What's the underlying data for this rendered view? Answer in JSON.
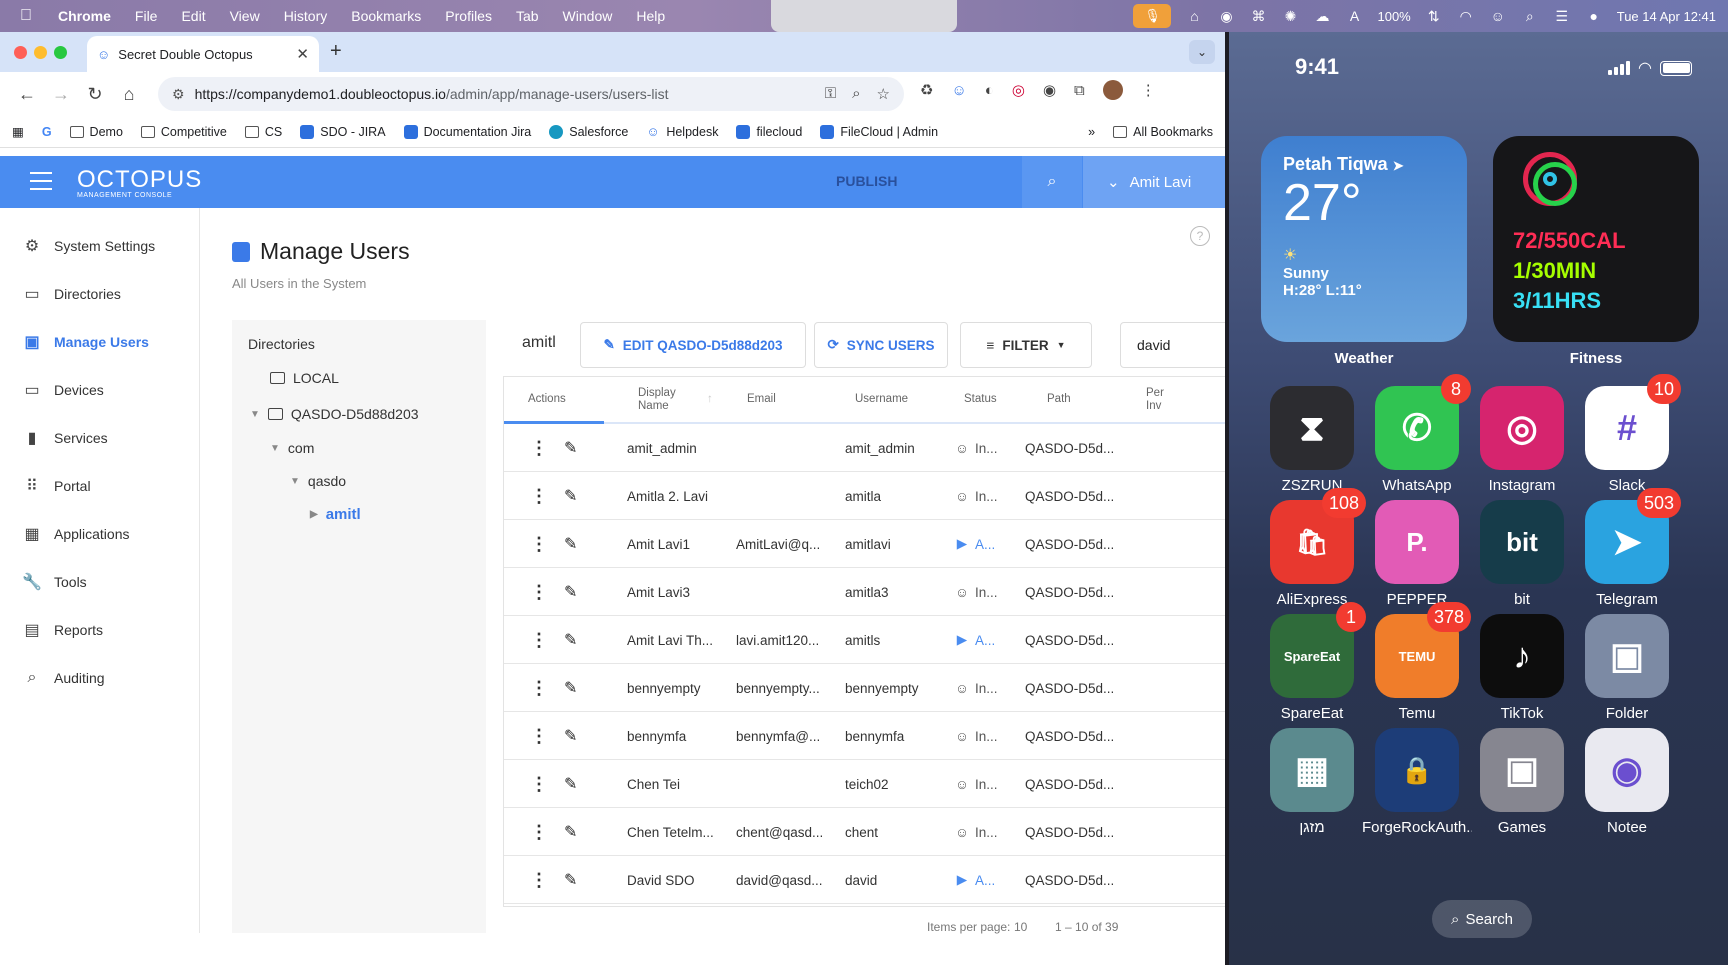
{
  "mac_menu": {
    "app": "Chrome",
    "items": [
      "File",
      "Edit",
      "View",
      "History",
      "Bookmarks",
      "Profiles",
      "Tab",
      "Window",
      "Help"
    ],
    "battery": "100%",
    "datetime": "Tue 14 Apr  12:41"
  },
  "browser": {
    "tab_title": "Secret Double Octopus",
    "url_host": "https://companydemo1.doubleoctopus.io",
    "url_path": "/admin/app/manage-users/users-list",
    "bookmarks": [
      "Demo",
      "Competitive",
      "CS",
      "SDO - JIRA",
      "Documentation Jira",
      "Salesforce",
      "Helpdesk",
      "filecloud",
      "FileCloud | Admin"
    ],
    "all_bookmarks": "All Bookmarks"
  },
  "app": {
    "logo": "OCTOPUS",
    "logo_sub": "MANAGEMENT CONSOLE",
    "publish": "PUBLISH",
    "user": "Amit Lavi",
    "sidebar": [
      {
        "label": "System Settings",
        "icon": "gear-icon"
      },
      {
        "label": "Directories",
        "icon": "folder-icon"
      },
      {
        "label": "Manage Users",
        "icon": "user-badge-icon"
      },
      {
        "label": "Devices",
        "icon": "laptop-icon"
      },
      {
        "label": "Services",
        "icon": "bookmark-icon"
      },
      {
        "label": "Portal",
        "icon": "grid-icon"
      },
      {
        "label": "Applications",
        "icon": "apps-icon"
      },
      {
        "label": "Tools",
        "icon": "wrench-icon"
      },
      {
        "label": "Reports",
        "icon": "clipboard-icon"
      },
      {
        "label": "Auditing",
        "icon": "audit-icon"
      }
    ],
    "page_title": "Manage Users",
    "page_subtitle": "All Users in the System",
    "directories": {
      "heading": "Directories",
      "local": "LOCAL",
      "root": "QASDO-D5d88d203",
      "com": "com",
      "qasdo": "qasdo",
      "selected": "amitl"
    },
    "grid": {
      "current_dir": "amitl",
      "edit_label": "EDIT QASDO-D5d88d203",
      "sync_label": "SYNC USERS",
      "filter_label": "FILTER",
      "search_value": "david",
      "columns": {
        "actions": "Actions",
        "display_name_1": "Display",
        "display_name_2": "Name",
        "email": "Email",
        "username": "Username",
        "status": "Status",
        "path": "Path",
        "per_1": "Per",
        "per_2": "Inv"
      },
      "rows": [
        {
          "name": "amit_admin",
          "email": "",
          "username": "amit_admin",
          "status": "In...",
          "active": false,
          "path": "QASDO-D5d..."
        },
        {
          "name": "Amitla 2. Lavi",
          "email": "",
          "username": "amitla",
          "status": "In...",
          "active": false,
          "path": "QASDO-D5d..."
        },
        {
          "name": "Amit Lavi1",
          "email": "AmitLavi@q...",
          "username": "amitlavi",
          "status": "A...",
          "active": true,
          "path": "QASDO-D5d..."
        },
        {
          "name": "Amit Lavi3",
          "email": "",
          "username": "amitla3",
          "status": "In...",
          "active": false,
          "path": "QASDO-D5d..."
        },
        {
          "name": "Amit Lavi Th...",
          "email": "lavi.amit120...",
          "username": "amitls",
          "status": "A...",
          "active": true,
          "path": "QASDO-D5d..."
        },
        {
          "name": "bennyempty",
          "email": "bennyempty...",
          "username": "bennyempty",
          "status": "In...",
          "active": false,
          "path": "QASDO-D5d..."
        },
        {
          "name": "bennymfa",
          "email": "bennymfa@...",
          "username": "bennymfa",
          "status": "In...",
          "active": false,
          "path": "QASDO-D5d..."
        },
        {
          "name": "Chen Tei",
          "email": "",
          "username": "teich02",
          "status": "In...",
          "active": false,
          "path": "QASDO-D5d..."
        },
        {
          "name": "Chen Tetelm...",
          "email": "chent@qasd...",
          "username": "chent",
          "status": "In...",
          "active": false,
          "path": "QASDO-D5d..."
        },
        {
          "name": "David SDO",
          "email": "david@qasd...",
          "username": "david",
          "status": "A...",
          "active": true,
          "path": "QASDO-D5d..."
        }
      ],
      "items_per_page_label": "Items per page:",
      "items_per_page": "10",
      "range": "1 – 10 of 39"
    }
  },
  "phone": {
    "time": "9:41",
    "weather": {
      "city": "Petah Tiqwa",
      "temp": "27°",
      "cond": "Sunny",
      "hilo": "H:28° L:11°",
      "label": "Weather"
    },
    "fitness": {
      "cal": "72/550CAL",
      "min": "1/30MIN",
      "hrs": "3/11HRS",
      "label": "Fitness"
    },
    "apps": [
      {
        "label": "ZSZRUN",
        "badge": "",
        "bg": "#2c2c30",
        "glyph": "⧗"
      },
      {
        "label": "WhatsApp",
        "badge": "8",
        "bg": "#30c452",
        "glyph": "✆"
      },
      {
        "label": "Instagram",
        "badge": "",
        "bg": "#d6246e",
        "glyph": "◎"
      },
      {
        "label": "Slack",
        "badge": "10",
        "bg": "#ffffff",
        "glyph": "#"
      },
      {
        "label": "AliExpress",
        "badge": "108",
        "bg": "#e8382f",
        "glyph": "🛍"
      },
      {
        "label": "PEPPER",
        "badge": "",
        "bg": "#e25bb6",
        "glyph": "P."
      },
      {
        "label": "bit",
        "badge": "",
        "bg": "#163c4a",
        "glyph": "bit"
      },
      {
        "label": "Telegram",
        "badge": "503",
        "bg": "#2aa3e0",
        "glyph": "➤"
      },
      {
        "label": "SpareEat",
        "badge": "1",
        "bg": "#2f6b3a",
        "glyph": "SpareEat"
      },
      {
        "label": "Temu",
        "badge": "378",
        "bg": "#f07d2a",
        "glyph": "TEMU"
      },
      {
        "label": "TikTok",
        "badge": "",
        "bg": "#0d0d0d",
        "glyph": "♪"
      },
      {
        "label": "Folder",
        "badge": "",
        "bg": "#7c8aa4",
        "glyph": "▣"
      },
      {
        "label": "מזגן",
        "badge": "",
        "bg": "#5b8a8e",
        "glyph": "▦"
      },
      {
        "label": "ForgeRockAuth...",
        "badge": "",
        "bg": "#1d3d78",
        "glyph": "🔒"
      },
      {
        "label": "Games",
        "badge": "",
        "bg": "#868690",
        "glyph": "▣"
      },
      {
        "label": "Notee",
        "badge": "",
        "bg": "#e9e9f0",
        "glyph": "◉"
      }
    ],
    "search": "Search"
  }
}
